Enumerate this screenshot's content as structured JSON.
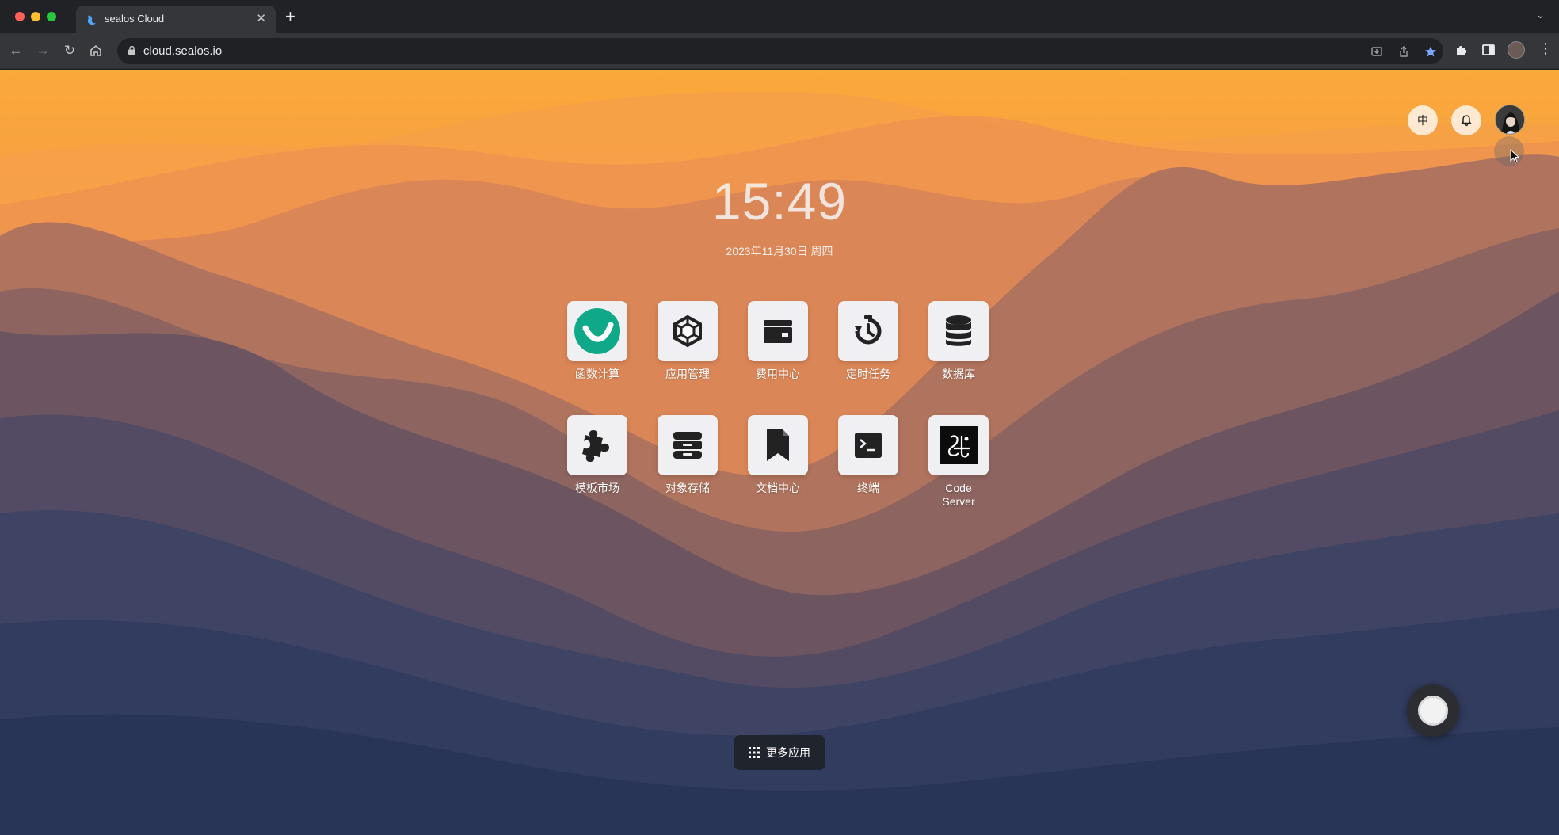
{
  "browser": {
    "tab_title": "sealos Cloud",
    "url": "cloud.sealos.io"
  },
  "desktop": {
    "time": "15:49",
    "date": "2023年11月30日 周四",
    "lang_button": "中",
    "apps": [
      {
        "label": "函数计算",
        "icon": "laf-icon"
      },
      {
        "label": "应用管理",
        "icon": "app-launchpad-icon"
      },
      {
        "label": "费用中心",
        "icon": "wallet-icon"
      },
      {
        "label": "定时任务",
        "icon": "stopwatch-icon"
      },
      {
        "label": "数据库",
        "icon": "database-icon"
      },
      {
        "label": "模板市场",
        "icon": "puzzle-icon"
      },
      {
        "label": "对象存储",
        "icon": "storage-cabinet-icon"
      },
      {
        "label": "文档中心",
        "icon": "bookmark-doc-icon"
      },
      {
        "label": "终端",
        "icon": "terminal-icon"
      },
      {
        "label": "Code Server",
        "icon": "code-server-icon"
      }
    ],
    "more_apps": "更多应用",
    "colors": {
      "sky_top": "#f9a53a",
      "sky_mid": "#e98f4d",
      "valley": "#2b3a5c",
      "laf_green": "#0fa98a"
    }
  }
}
